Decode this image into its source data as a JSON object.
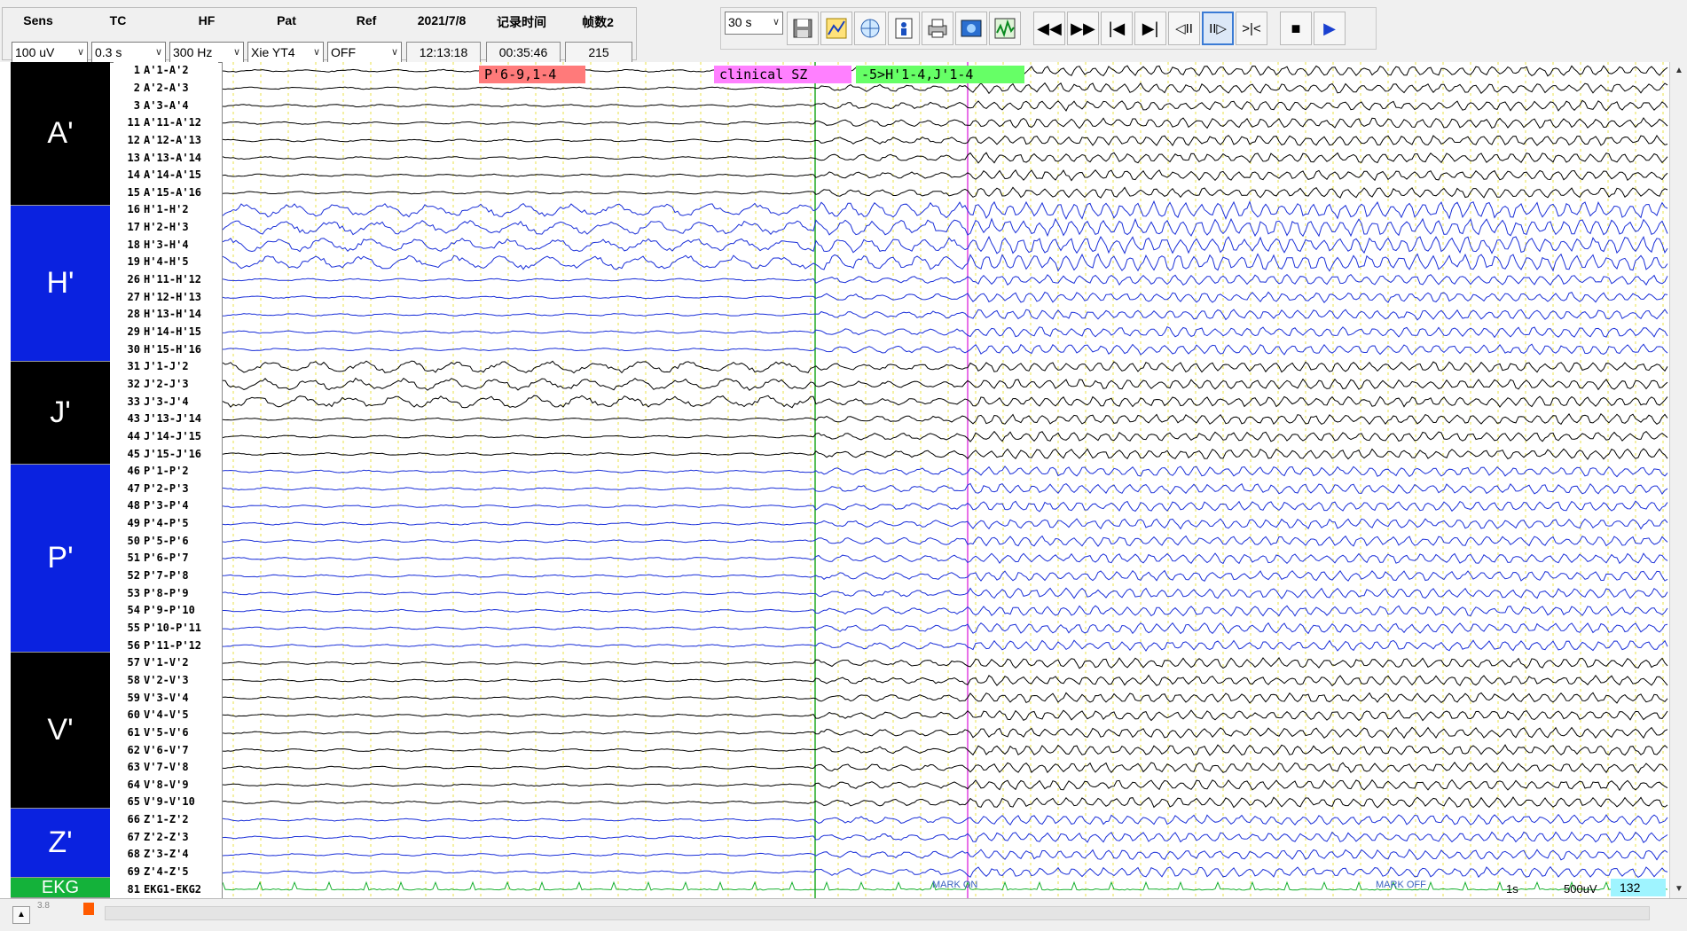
{
  "toolbar": {
    "labels": [
      "Sens",
      "TC",
      "HF",
      "Pat",
      "Ref"
    ],
    "sens": "100 uV",
    "tc": "0.3 s",
    "hf": "300 Hz",
    "pat": "Xie YT4",
    "ref": "OFF",
    "date": "2021/7/8",
    "time": "12:13:18",
    "record_time_label": "记录时间",
    "record_time": "00:35:46",
    "frame_label": "帧数2",
    "frame_count": "215",
    "page_duration": "30 s"
  },
  "toolbar_icons": [
    "save-icon",
    "montage-icon",
    "filter-icon",
    "patient-info-icon",
    "print-icon",
    "photo-icon",
    "trend-icon"
  ],
  "playback_icons": [
    "rewind-icon",
    "fast-forward-icon",
    "skip-start-icon",
    "skip-end-icon",
    "step-back-icon",
    "step-forward-icon",
    "collapse-icon",
    "stop-icon",
    "play-icon"
  ],
  "groups": [
    {
      "label": "A'",
      "color": "#000000"
    },
    {
      "label": "H'",
      "color": "#0a22e0"
    },
    {
      "label": "J'",
      "color": "#000000"
    },
    {
      "label": "P'",
      "color": "#0a22e0"
    },
    {
      "label": "V'",
      "color": "#000000"
    },
    {
      "label": "Z'",
      "color": "#0a22e0"
    },
    {
      "label": "EKG",
      "color": "#14b23a"
    }
  ],
  "channels": [
    {
      "num": "1",
      "label": "A'1-A'2"
    },
    {
      "num": "2",
      "label": "A'2-A'3"
    },
    {
      "num": "3",
      "label": "A'3-A'4"
    },
    {
      "num": "11",
      "label": "A'11-A'12"
    },
    {
      "num": "12",
      "label": "A'12-A'13"
    },
    {
      "num": "13",
      "label": "A'13-A'14"
    },
    {
      "num": "14",
      "label": "A'14-A'15"
    },
    {
      "num": "15",
      "label": "A'15-A'16"
    },
    {
      "num": "16",
      "label": "H'1-H'2"
    },
    {
      "num": "17",
      "label": "H'2-H'3"
    },
    {
      "num": "18",
      "label": "H'3-H'4"
    },
    {
      "num": "19",
      "label": "H'4-H'5"
    },
    {
      "num": "26",
      "label": "H'11-H'12"
    },
    {
      "num": "27",
      "label": "H'12-H'13"
    },
    {
      "num": "28",
      "label": "H'13-H'14"
    },
    {
      "num": "29",
      "label": "H'14-H'15"
    },
    {
      "num": "30",
      "label": "H'15-H'16"
    },
    {
      "num": "31",
      "label": "J'1-J'2"
    },
    {
      "num": "32",
      "label": "J'2-J'3"
    },
    {
      "num": "33",
      "label": "J'3-J'4"
    },
    {
      "num": "43",
      "label": "J'13-J'14"
    },
    {
      "num": "44",
      "label": "J'14-J'15"
    },
    {
      "num": "45",
      "label": "J'15-J'16"
    },
    {
      "num": "46",
      "label": "P'1-P'2"
    },
    {
      "num": "47",
      "label": "P'2-P'3"
    },
    {
      "num": "48",
      "label": "P'3-P'4"
    },
    {
      "num": "49",
      "label": "P'4-P'5"
    },
    {
      "num": "50",
      "label": "P'5-P'6"
    },
    {
      "num": "51",
      "label": "P'6-P'7"
    },
    {
      "num": "52",
      "label": "P'7-P'8"
    },
    {
      "num": "53",
      "label": "P'8-P'9"
    },
    {
      "num": "54",
      "label": "P'9-P'10"
    },
    {
      "num": "55",
      "label": "P'10-P'11"
    },
    {
      "num": "56",
      "label": "P'11-P'12"
    },
    {
      "num": "57",
      "label": "V'1-V'2"
    },
    {
      "num": "58",
      "label": "V'2-V'3"
    },
    {
      "num": "59",
      "label": "V'3-V'4"
    },
    {
      "num": "60",
      "label": "V'4-V'5"
    },
    {
      "num": "61",
      "label": "V'5-V'6"
    },
    {
      "num": "62",
      "label": "V'6-V'7"
    },
    {
      "num": "63",
      "label": "V'7-V'8"
    },
    {
      "num": "64",
      "label": "V'8-V'9"
    },
    {
      "num": "65",
      "label": "V'9-V'10"
    },
    {
      "num": "66",
      "label": "Z'1-Z'2"
    },
    {
      "num": "67",
      "label": "Z'2-Z'3"
    },
    {
      "num": "68",
      "label": "Z'3-Z'4"
    },
    {
      "num": "69",
      "label": "Z'4-Z'5"
    },
    {
      "num": "81",
      "label": "EKG1-EKG2"
    }
  ],
  "annotations": [
    {
      "text": "P'6-9,1-4",
      "color": "#ff7a7a"
    },
    {
      "text": "clinical SZ",
      "color": "#ff80ff"
    },
    {
      "text": "-5>H'1-4,J'1-4",
      "color": "#66ff66"
    }
  ],
  "markers": [
    {
      "text": "MARK ON"
    },
    {
      "text": "MARK OFF"
    }
  ],
  "scale": {
    "time": "1s",
    "amplitude": "500uV",
    "count": "132"
  },
  "bottom": {
    "zoom": "3.8"
  },
  "colors": {
    "trace_black": "#000000",
    "trace_blue": "#1a2fd8",
    "trace_green": "#18b030",
    "grid_yellow": "#e8e04a",
    "onset_green": "#22aa22",
    "sz_magenta": "#e040e0"
  }
}
